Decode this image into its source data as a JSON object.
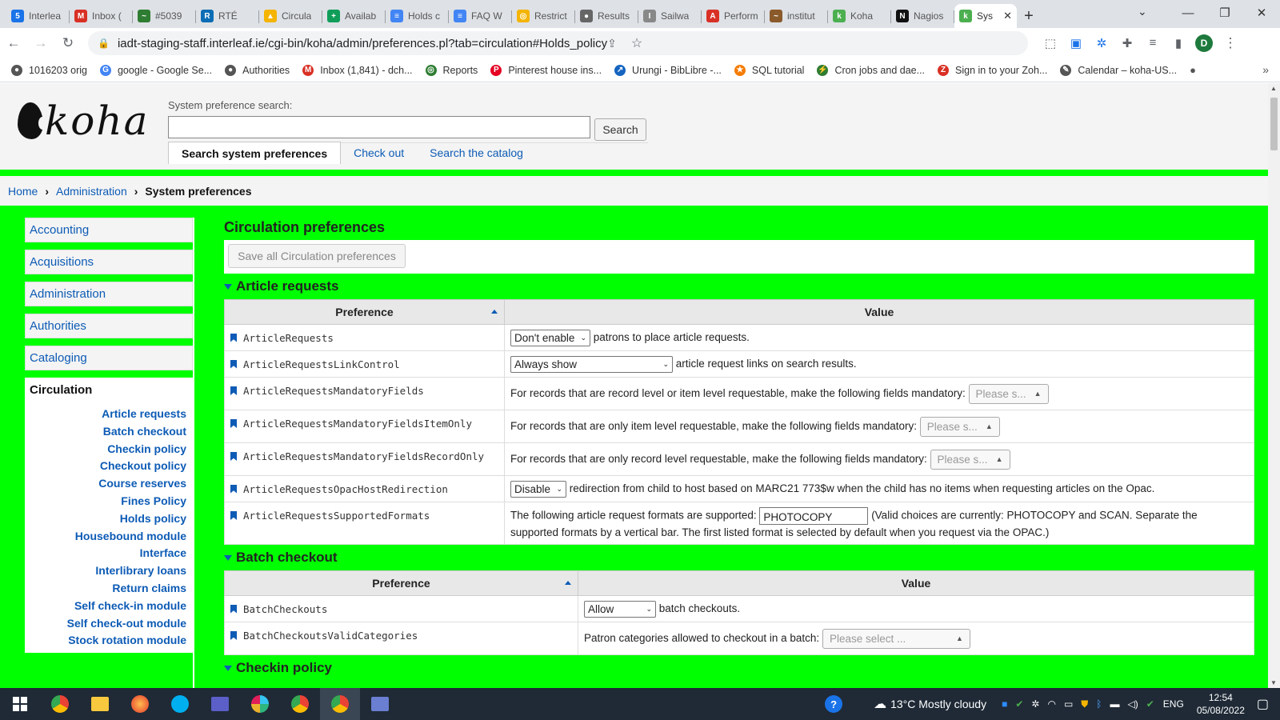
{
  "browser": {
    "tabs": [
      {
        "label": "Interlea",
        "icon": "5",
        "color": "#1a73e8"
      },
      {
        "label": "Inbox (",
        "icon": "M",
        "color": "#d93025"
      },
      {
        "label": "#5039",
        "icon": "~",
        "color": "#2e7d32"
      },
      {
        "label": "RTÉ",
        "icon": "R",
        "color": "#0b6db5"
      },
      {
        "label": "Circula",
        "icon": "▲",
        "color": "#f4b400"
      },
      {
        "label": "Availab",
        "icon": "+",
        "color": "#0f9d58"
      },
      {
        "label": "Holds c",
        "icon": "≡",
        "color": "#4285f4"
      },
      {
        "label": "FAQ W",
        "icon": "≡",
        "color": "#4285f4"
      },
      {
        "label": "Restrict",
        "icon": "◎",
        "color": "#f4b400"
      },
      {
        "label": "Results",
        "icon": "●",
        "color": "#666666"
      },
      {
        "label": "Sailwa",
        "icon": "I",
        "color": "#888888"
      },
      {
        "label": "Perform",
        "icon": "A",
        "color": "#d93025"
      },
      {
        "label": "institut",
        "icon": "~",
        "color": "#8a5a2b"
      },
      {
        "label": "Koha",
        "icon": "k",
        "color": "#4caf50"
      },
      {
        "label": "Nagios",
        "icon": "N",
        "color": "#111111"
      },
      {
        "label": "Sys",
        "icon": "k",
        "color": "#4caf50",
        "active": true
      }
    ],
    "url": "iadt-staging-staff.interleaf.ie/cgi-bin/koha/admin/preferences.pl?tab=circulation#Holds_policy",
    "bookmarks": [
      {
        "label": "1016203 orig",
        "color": "#555555",
        "icon": "●"
      },
      {
        "label": "google - Google Se...",
        "color": "#4285f4",
        "icon": "G"
      },
      {
        "label": "Authorities",
        "color": "#555555",
        "icon": "●"
      },
      {
        "label": "Inbox (1,841) - dch...",
        "color": "#d93025",
        "icon": "M"
      },
      {
        "label": "Reports",
        "color": "#2e7d32",
        "icon": "◎"
      },
      {
        "label": "Pinterest house ins...",
        "color": "#e60023",
        "icon": "P"
      },
      {
        "label": "Urungi - BibLibre -...",
        "color": "#1565c0",
        "icon": "↗"
      },
      {
        "label": "SQL tutorial",
        "color": "#f57c00",
        "icon": "★"
      },
      {
        "label": "Cron jobs and dae...",
        "color": "#2e7d32",
        "icon": "⚡"
      },
      {
        "label": "Sign in to your Zoh...",
        "color": "#d93025",
        "icon": "Z"
      },
      {
        "label": "Calendar – koha-US...",
        "color": "#555555",
        "icon": "✎"
      }
    ],
    "avatar_letter": "D"
  },
  "koha": {
    "logo_text": "koha",
    "search_label": "System preference search:",
    "search_value": "",
    "search_button": "Search",
    "header_tabs": [
      "Search system preferences",
      "Check out",
      "Search the catalog"
    ],
    "breadcrumb": {
      "home": "Home",
      "admin": "Administration",
      "current": "System preferences"
    },
    "nav_items": [
      "Accounting",
      "Acquisitions",
      "Administration",
      "Authorities",
      "Cataloging",
      "Circulation"
    ],
    "sub_items": [
      "Article requests",
      "Batch checkout",
      "Checkin policy",
      "Checkout policy",
      "Course reserves",
      "Fines Policy",
      "Holds policy",
      "Housebound module",
      "Interface",
      "Interlibrary loans",
      "Return claims",
      "Self check-in module",
      "Self check-out module",
      "Stock rotation module"
    ],
    "page_title": "Circulation preferences",
    "save_button": "Save all Circulation preferences",
    "col_pref": "Preference",
    "col_value": "Value",
    "article_section": "Article requests",
    "rows": {
      "r1": {
        "name": "ArticleRequests",
        "select": "Don't enable",
        "text": "patrons to place article requests."
      },
      "r2": {
        "name": "ArticleRequestsLinkControl",
        "select": "Always show",
        "text": "article request links on search results."
      },
      "r3": {
        "name": "ArticleRequestsMandatoryFields",
        "text": "For records that are record level or item level requestable, make the following fields mandatory:",
        "placeholder": "Please s..."
      },
      "r4": {
        "name": "ArticleRequestsMandatoryFieldsItemOnly",
        "text": "For records that are only item level requestable, make the following fields mandatory:",
        "placeholder": "Please s..."
      },
      "r5": {
        "name": "ArticleRequestsMandatoryFieldsRecordOnly",
        "text": "For records that are only record level requestable, make the following fields mandatory:",
        "placeholder": "Please s..."
      },
      "r6": {
        "name": "ArticleRequestsOpacHostRedirection",
        "select": "Disable",
        "text": "redirection from child to host based on MARC21 773$w when the child has no items when requesting articles on the Opac."
      },
      "r7": {
        "name": "ArticleRequestsSupportedFormats",
        "text_before": "The following article request formats are supported:",
        "input": "PHOTOCOPY",
        "text_after": "(Valid choices are currently: PHOTOCOPY and SCAN. Separate the supported formats by a vertical bar. The first listed format is selected by default when you request via the OPAC.)"
      }
    },
    "batch_section": "Batch checkout",
    "batch_rows": {
      "b1": {
        "name": "BatchCheckouts",
        "select": "Allow",
        "text": "batch checkouts."
      },
      "b2": {
        "name": "BatchCheckoutsValidCategories",
        "text": "Patron categories allowed to checkout in a batch:",
        "placeholder": "Please select ..."
      }
    },
    "checkin_section": "Checkin policy"
  },
  "taskbar": {
    "weather": "13°C  Mostly cloudy",
    "lang": "ENG",
    "time": "12:54",
    "date": "05/08/2022"
  }
}
